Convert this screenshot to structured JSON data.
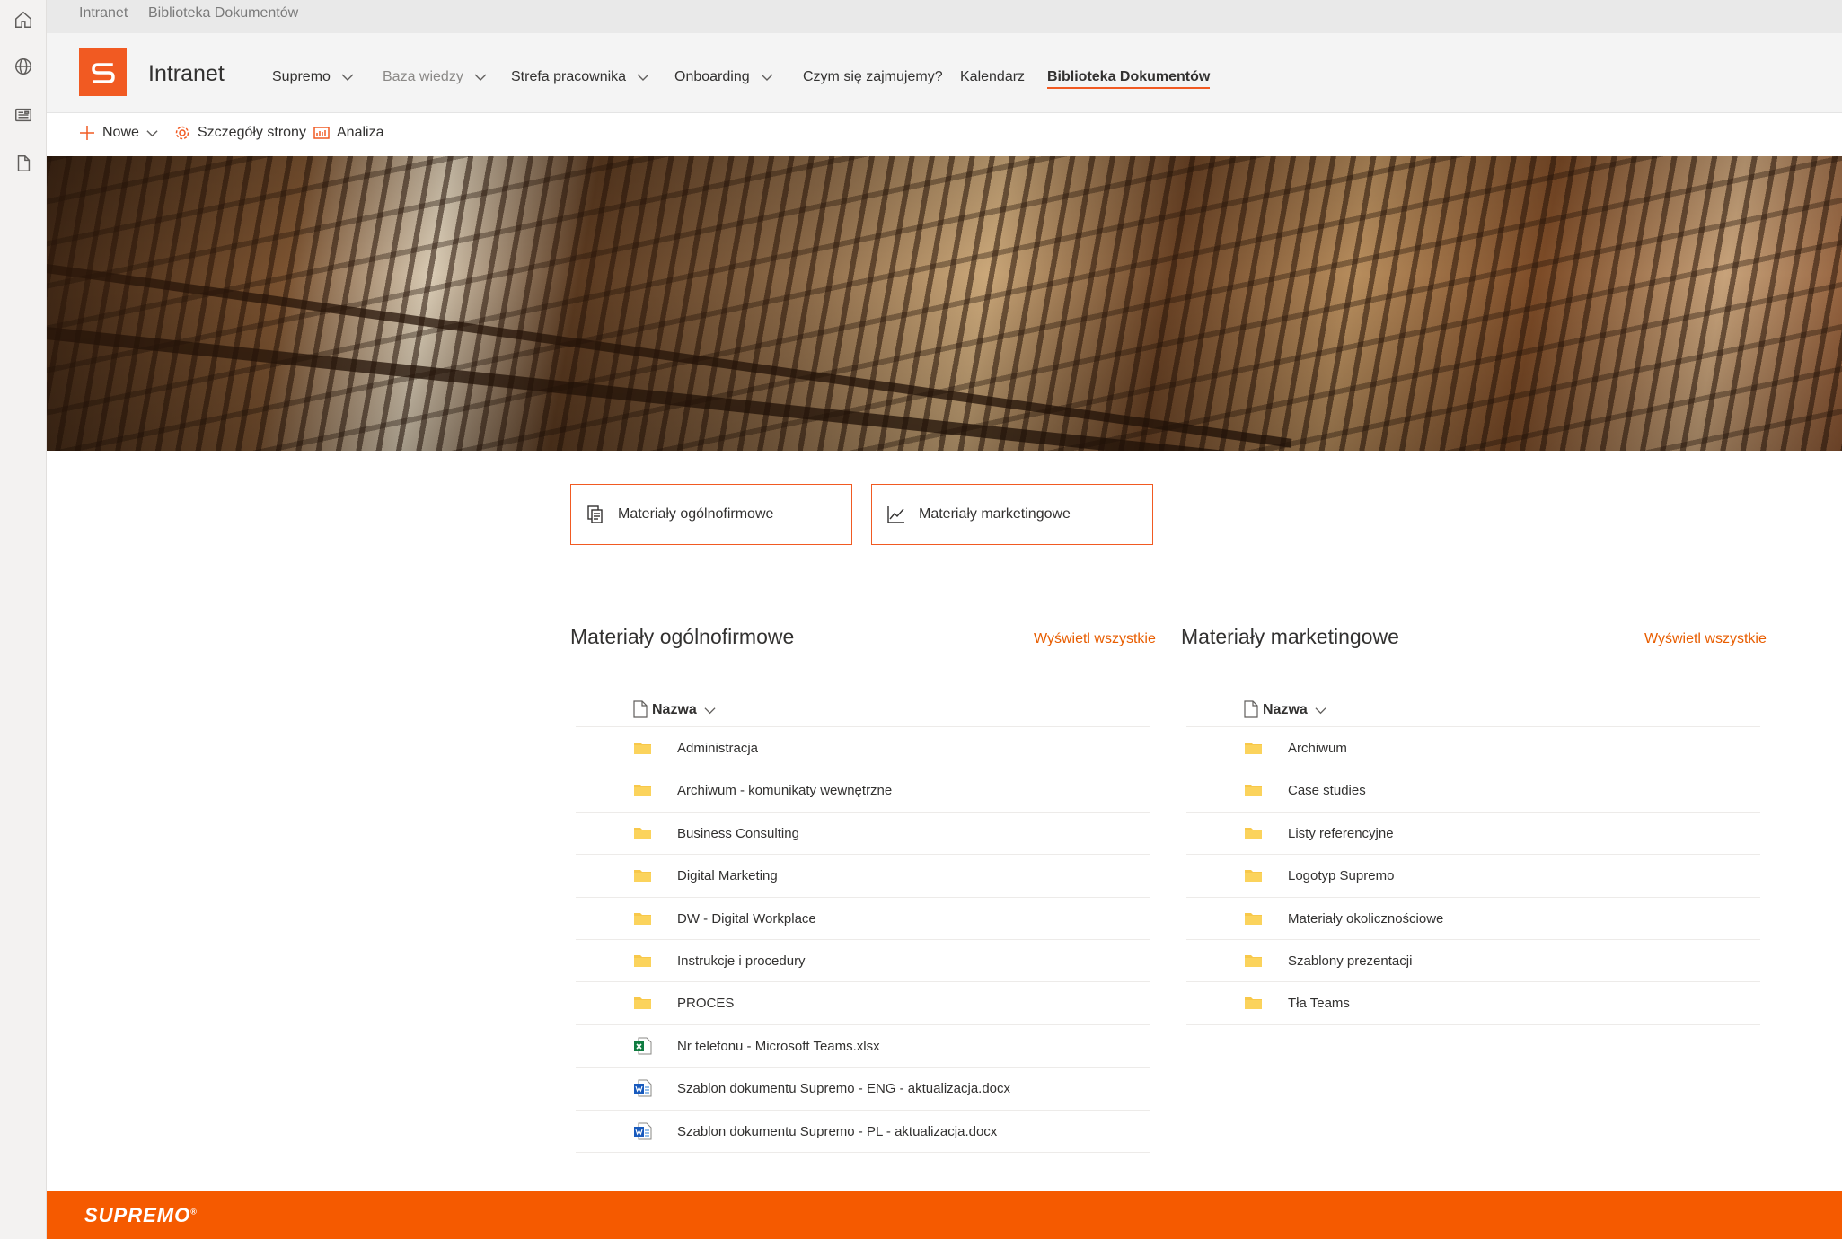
{
  "breadcrumb": {
    "items": [
      "Intranet",
      "Biblioteka Dokumentów"
    ]
  },
  "site": {
    "title": "Intranet",
    "logo_letter": "S"
  },
  "nav": [
    {
      "label": "Supremo",
      "dropdown": true
    },
    {
      "label": "Baza wiedzy",
      "dropdown": true
    },
    {
      "label": "Strefa pracownika",
      "dropdown": true
    },
    {
      "label": "Onboarding",
      "dropdown": true
    },
    {
      "label": "Czym się zajmujemy?",
      "dropdown": false
    },
    {
      "label": "Kalendarz",
      "dropdown": false
    },
    {
      "label": "Biblioteka Dokumentów",
      "dropdown": false,
      "active": true
    }
  ],
  "commands": {
    "new": "Nowe",
    "details": "Szczegóły strony",
    "analytics": "Analiza"
  },
  "quick_links": [
    {
      "label": "Materiały ogólnofirmowe",
      "icon": "documents-icon"
    },
    {
      "label": "Materiały marketingowe",
      "icon": "chart-line-icon"
    }
  ],
  "sections": [
    {
      "title": "Materiały ogólnofirmowe",
      "view_all": "Wyświetl wszystkie",
      "column_name": "Nazwa",
      "items": [
        {
          "name": "Administracja",
          "type": "folder"
        },
        {
          "name": "Archiwum - komunikaty wewnętrzne",
          "type": "folder"
        },
        {
          "name": "Business Consulting",
          "type": "folder"
        },
        {
          "name": "Digital Marketing",
          "type": "folder"
        },
        {
          "name": "DW - Digital Workplace",
          "type": "folder"
        },
        {
          "name": "Instrukcje i procedury",
          "type": "folder"
        },
        {
          "name": "PROCES",
          "type": "folder"
        },
        {
          "name": "Nr telefonu - Microsoft Teams.xlsx",
          "type": "xlsx"
        },
        {
          "name": "Szablon dokumentu Supremo - ENG - aktualizacja.docx",
          "type": "docx"
        },
        {
          "name": "Szablon dokumentu Supremo - PL - aktualizacja.docx",
          "type": "docx"
        }
      ]
    },
    {
      "title": "Materiały marketingowe",
      "view_all": "Wyświetl wszystkie",
      "column_name": "Nazwa",
      "items": [
        {
          "name": "Archiwum",
          "type": "folder"
        },
        {
          "name": "Case studies",
          "type": "folder"
        },
        {
          "name": "Listy referencyjne",
          "type": "folder"
        },
        {
          "name": "Logotyp Supremo",
          "type": "folder"
        },
        {
          "name": "Materiały okolicznościowe",
          "type": "folder"
        },
        {
          "name": "Szablony prezentacji",
          "type": "folder"
        },
        {
          "name": "Tła Teams",
          "type": "folder"
        }
      ]
    }
  ],
  "footer": {
    "brand": "SUPREMO",
    "mark": "®"
  },
  "colors": {
    "accent": "#f15a22",
    "footer": "#f55a00",
    "link": "#e85d00",
    "folder": "#f8c84a"
  }
}
